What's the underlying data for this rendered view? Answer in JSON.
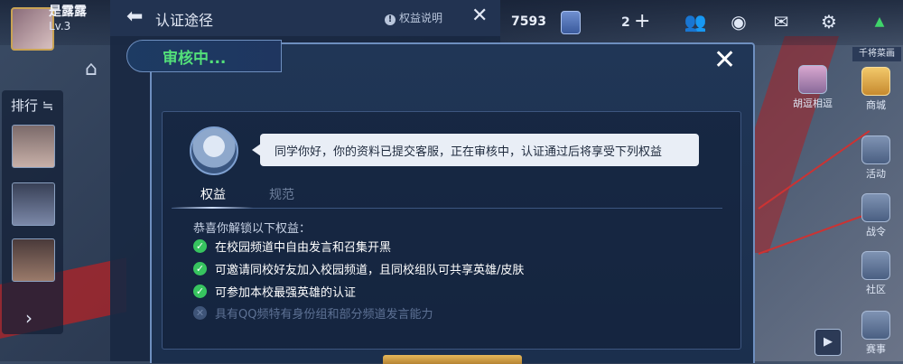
{
  "player": {
    "name": "是露露",
    "level": "Lv.3"
  },
  "topbar": {
    "coins": "7593",
    "gems": "2"
  },
  "rank_panel": {
    "title": "排行 ≒"
  },
  "under_panel": {
    "title": "认证途径",
    "info_label": "权益说明"
  },
  "dialog": {
    "status": "审核中...",
    "message": "同学你好，你的资料已提交客服，正在审核中，认证通过后将享受下列权益",
    "tabs": [
      {
        "label": "权益",
        "active": true
      },
      {
        "label": "规范",
        "active": false
      }
    ],
    "benefits_header": "恭喜你解锁以下权益：",
    "benefits": [
      {
        "text": "在校园频道中自由发言和召集开黑",
        "unlocked": true
      },
      {
        "text": "可邀请同校好友加入校园频道，且同校组队可共享英雄/皮肤",
        "unlocked": true
      },
      {
        "text": "可参加本校最强英雄的认证",
        "unlocked": true
      },
      {
        "text": "具有QQ频特有身份组和部分频道发言能力",
        "unlocked": false
      }
    ]
  },
  "right_rail": {
    "top_label": "千将菜画",
    "items": [
      "商城",
      "活动",
      "战令",
      "社区",
      "赛事"
    ],
    "left_event": "胡逗相逗"
  },
  "colors": {
    "status_green": "#53e07a",
    "check_green": "#37c45f",
    "accent_gold": "#c9a354"
  }
}
